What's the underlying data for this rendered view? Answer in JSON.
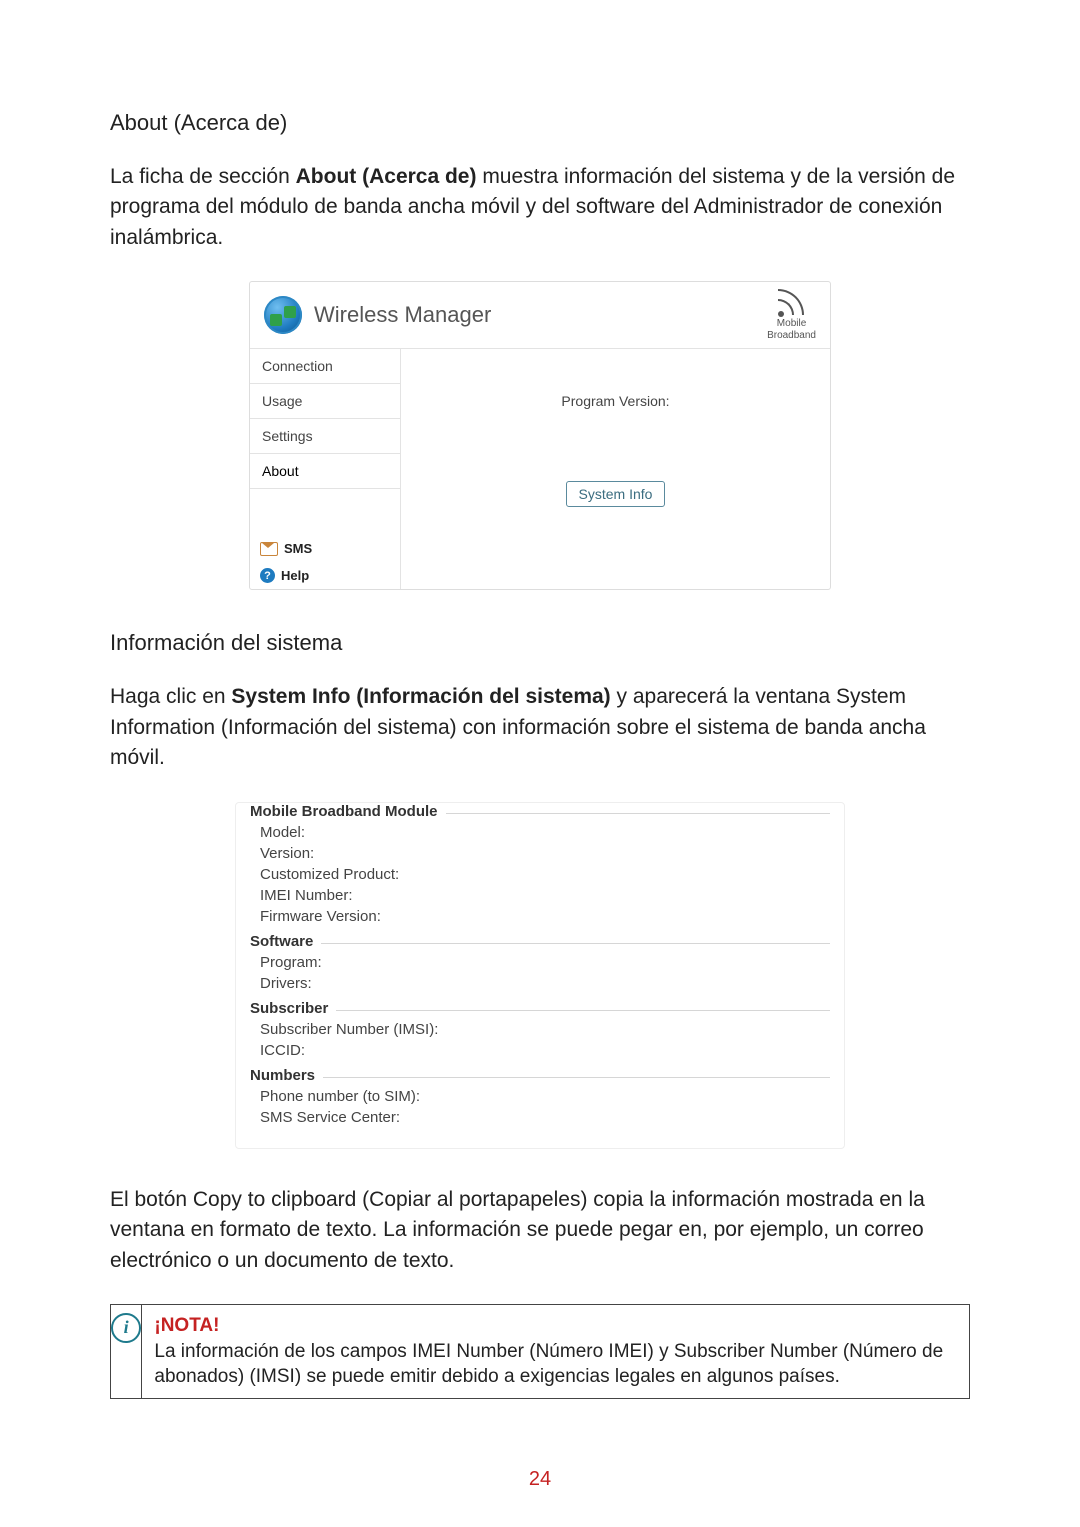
{
  "section_heading": "About (Acerca de)",
  "section_intro_pre": "La ficha de sección ",
  "section_intro_bold": "About (Acerca de)",
  "section_intro_post": " muestra información del sistema y de la versión de programa del módulo de banda ancha móvil y del software del Administrador de conexión inalámbrica.",
  "wm": {
    "title": "Wireless Manager",
    "brand_line1": "Mobile",
    "brand_line2": "Broadband",
    "tabs": {
      "connection": "Connection",
      "usage": "Usage",
      "settings": "Settings",
      "about": "About"
    },
    "links": {
      "sms": "SMS",
      "help": "Help"
    },
    "program_version_label": "Program Version:",
    "system_info_btn": "System Info"
  },
  "subheading_sysinfo": "Información del sistema",
  "sysinfo_para_pre": "Haga clic en ",
  "sysinfo_para_bold": "System Info (Información del sistema)",
  "sysinfo_para_post": " y aparecerá la ventana System Information (Información del sistema) con información sobre el sistema de banda ancha móvil.",
  "sysinfo": {
    "g1_title": "Mobile Broadband Module",
    "g1": {
      "model": "Model:",
      "version": "Version:",
      "custom": "Customized Product:",
      "imei": "IMEI Number:",
      "fw": "Firmware Version:"
    },
    "g2_title": "Software",
    "g2": {
      "program": "Program:",
      "drivers": "Drivers:"
    },
    "g3_title": "Subscriber",
    "g3": {
      "imsi": "Subscriber Number (IMSI):",
      "iccid": "ICCID:"
    },
    "g4_title": "Numbers",
    "g4": {
      "phone": "Phone number (to SIM):",
      "smsc": "SMS Service Center:"
    }
  },
  "copy_para": "El botón Copy to clipboard (Copiar al portapapeles) copia la información mostrada en la ventana en formato de texto. La información se puede pegar en, por ejemplo, un correo electrónico o un documento de texto.",
  "note": {
    "title": "¡NOTA!",
    "body": "La información de los campos IMEI Number (Número IMEI) y Subscriber Number (Número de abonados) (IMSI) se puede emitir debido a exigencias legales en algunos países."
  },
  "page_number": "24"
}
